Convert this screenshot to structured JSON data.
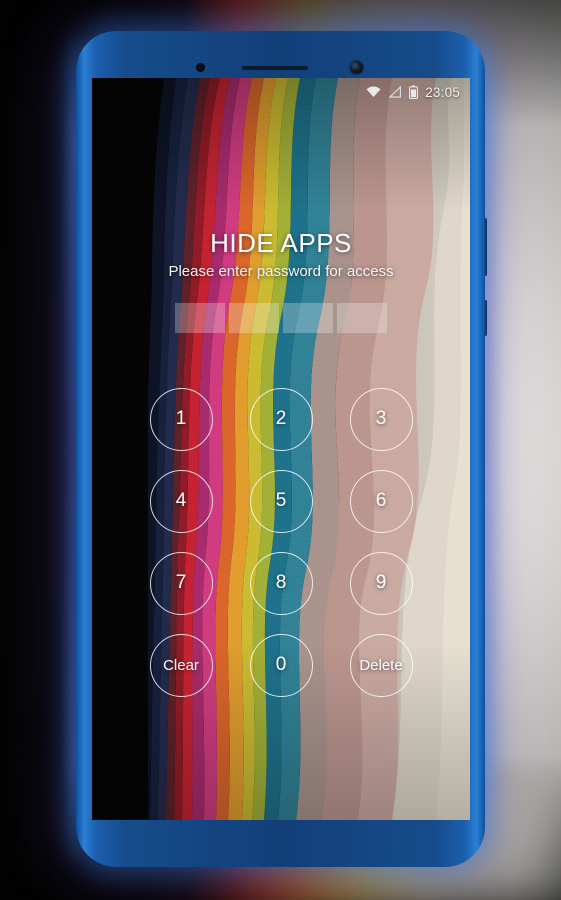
{
  "device": {
    "name": "android-smartphone",
    "bezel_color": "#164c8c",
    "edge_glow_color": "#2b7fd4"
  },
  "status_bar": {
    "icons": [
      "wifi-icon",
      "signal-triangle-icon",
      "battery-icon"
    ],
    "clock": "23:05"
  },
  "lock_screen": {
    "title": "HIDE APPS",
    "subtitle": "Please enter password for access",
    "password_field": {
      "value": "",
      "placeholder": "",
      "slots": 4,
      "slot_fill_color": "#ffffff"
    },
    "keypad": [
      {
        "name": "key-1",
        "label": "1",
        "type": "digit"
      },
      {
        "name": "key-2",
        "label": "2",
        "type": "digit"
      },
      {
        "name": "key-3",
        "label": "3",
        "type": "digit"
      },
      {
        "name": "key-4",
        "label": "4",
        "type": "digit"
      },
      {
        "name": "key-5",
        "label": "5",
        "type": "digit"
      },
      {
        "name": "key-6",
        "label": "6",
        "type": "digit"
      },
      {
        "name": "key-7",
        "label": "7",
        "type": "digit"
      },
      {
        "name": "key-8",
        "label": "8",
        "type": "digit"
      },
      {
        "name": "key-9",
        "label": "9",
        "type": "digit"
      },
      {
        "name": "key-clear",
        "label": "Clear",
        "type": "action"
      },
      {
        "name": "key-0",
        "label": "0",
        "type": "digit"
      },
      {
        "name": "key-delete",
        "label": "Delete",
        "type": "action"
      }
    ],
    "text_color": "#ffffff"
  },
  "wallpaper": {
    "style": "abstract-layered-paper-cut-waves",
    "palette": [
      "#060606",
      "#0d0d12",
      "#141a2e",
      "#1d2a4a",
      "#2b3c63",
      "#3d3038",
      "#5a3b3f",
      "#7a1f2b",
      "#a81f2e",
      "#cc2030",
      "#d13a4a",
      "#c2305f",
      "#d0437c",
      "#b5397f",
      "#8a2f6e",
      "#d4552a",
      "#e0762c",
      "#e89a2e",
      "#d9b235",
      "#b9bd34",
      "#8fae3a",
      "#2f8fa0",
      "#1f7c99",
      "#2a6f86",
      "#9d8a7e",
      "#b49a8e",
      "#c9b5a6",
      "#cfc7bb",
      "#bdb7ad",
      "#a8a49a"
    ]
  }
}
